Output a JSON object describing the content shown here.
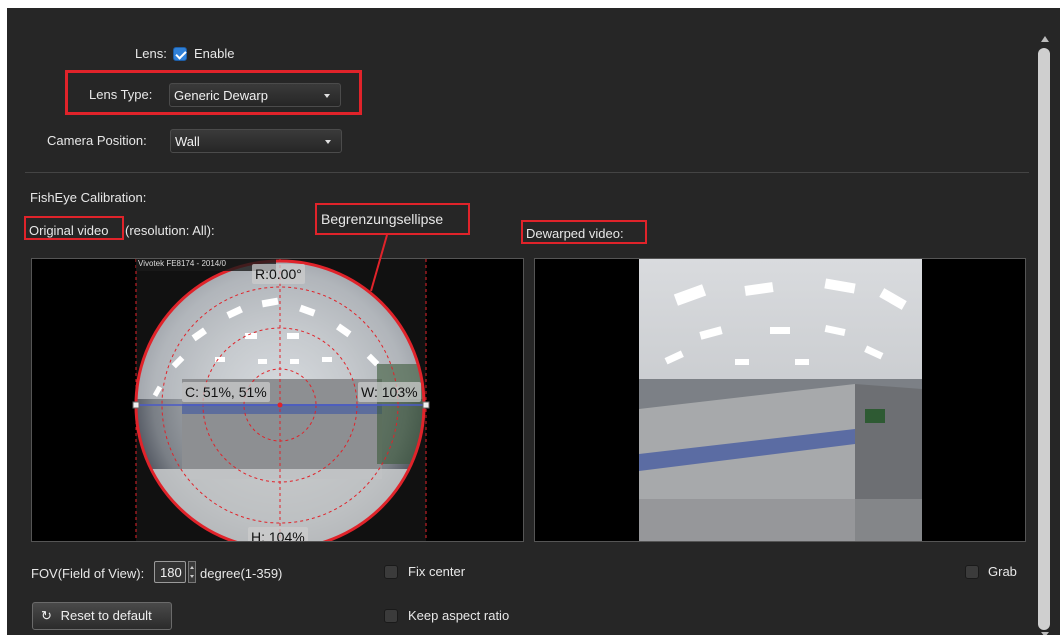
{
  "lens": {
    "label": "Lens:",
    "enable_label": "Enable",
    "enabled": true
  },
  "lens_type": {
    "label": "Lens Type:",
    "value": "Generic Dewarp"
  },
  "camera_position": {
    "label": "Camera Position:",
    "value": "Wall"
  },
  "calibration": {
    "title": "FishEye Calibration:",
    "original_video": "Original video",
    "resolution_suffix": "(resolution: All):",
    "dewarped_video": "Dewarped video:",
    "callout": "Begrenzungsellipse"
  },
  "fisheye_overlay": {
    "camera_text": "Vivotek FE8174 - 2014/0",
    "rotation": "R:0.00°",
    "center": "C: 51%, 51%",
    "width": "W: 103%",
    "height": "H: 104%"
  },
  "controls": {
    "fov_label": "FOV(Field of View):",
    "fov_value": "180",
    "fov_unit": "degree(1-359)",
    "fix_center": "Fix center",
    "keep_aspect": "Keep aspect ratio",
    "grab": "Grab",
    "reset": "Reset to default"
  },
  "colors": {
    "accent": "#e0232a",
    "background": "#262626",
    "checkbox": "#2f80d8"
  }
}
